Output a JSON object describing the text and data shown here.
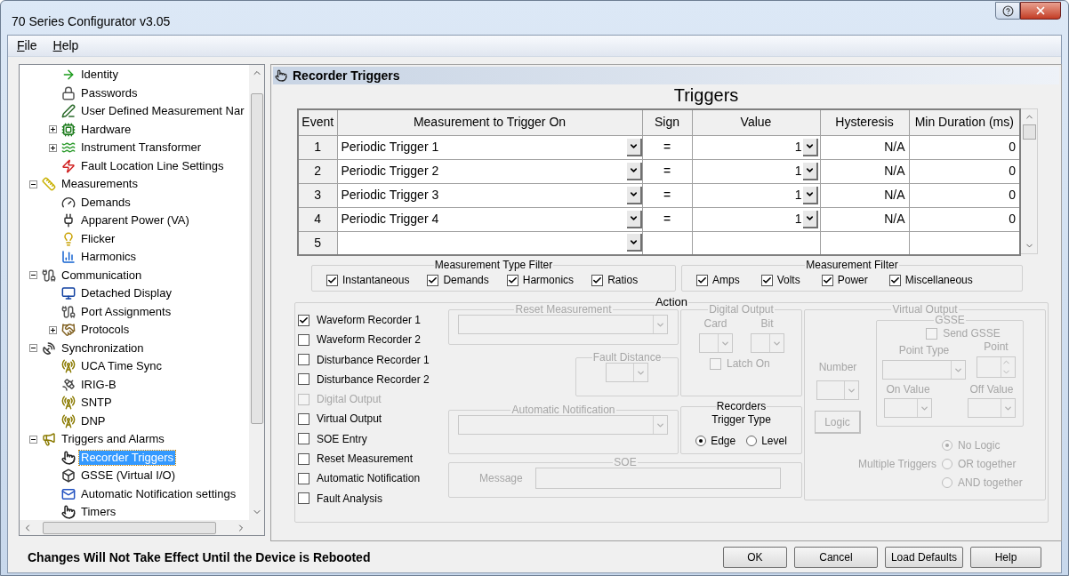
{
  "window": {
    "title": "70 Series Configurator v3.05"
  },
  "menu": [
    {
      "label": "File"
    },
    {
      "label": "Help"
    }
  ],
  "tree": {
    "continued_children": [
      {
        "label": "Identity",
        "selected": false
      },
      {
        "label": "Passwords",
        "selected": false
      },
      {
        "label": "User Defined Measurement Nar",
        "selected": false
      },
      {
        "label": "Hardware",
        "selected": false,
        "expanded": false
      },
      {
        "label": "Instrument Transformer",
        "selected": false,
        "expanded": false
      },
      {
        "label": "Fault Location Line Settings",
        "selected": false
      }
    ],
    "items": [
      {
        "label": "Measurements",
        "selected": false,
        "expanded": true,
        "children": [
          {
            "label": "Demands",
            "selected": false
          },
          {
            "label": "Apparent Power (VA)",
            "selected": false
          },
          {
            "label": "Flicker",
            "selected": false
          },
          {
            "label": "Harmonics",
            "selected": false
          }
        ]
      },
      {
        "label": "Communication",
        "selected": false,
        "expanded": true,
        "children": [
          {
            "label": "Detached Display",
            "selected": false
          },
          {
            "label": "Port Assignments",
            "selected": false
          },
          {
            "label": "Protocols",
            "selected": false,
            "expanded": false
          }
        ]
      },
      {
        "label": "Synchronization",
        "selected": false,
        "expanded": true,
        "children": [
          {
            "label": "UCA Time Sync",
            "selected": false
          },
          {
            "label": "IRIG-B",
            "selected": false
          },
          {
            "label": "SNTP",
            "selected": false
          },
          {
            "label": "DNP",
            "selected": false
          }
        ]
      },
      {
        "label": "Triggers and Alarms",
        "selected": false,
        "expanded": true,
        "children": [
          {
            "label": "Recorder Triggers",
            "selected": true
          },
          {
            "label": "GSSE (Virtual I/O)",
            "selected": false
          },
          {
            "label": "Automatic Notification settings",
            "selected": false
          },
          {
            "label": "Timers",
            "selected": false
          }
        ]
      }
    ]
  },
  "panel": {
    "title": "Recorder Triggers"
  },
  "triggers": {
    "title": "Triggers",
    "columns": [
      "Event",
      "Measurement to Trigger On",
      "Sign",
      "Value",
      "Hysteresis",
      "Min Duration (ms)"
    ],
    "rows": [
      {
        "event": "1",
        "measurement": "Periodic Trigger 1",
        "sign": "=",
        "value": "1",
        "hysteresis": "N/A",
        "min_duration": "0"
      },
      {
        "event": "2",
        "measurement": "Periodic Trigger 2",
        "sign": "=",
        "value": "1",
        "hysteresis": "N/A",
        "min_duration": "0"
      },
      {
        "event": "3",
        "measurement": "Periodic Trigger 3",
        "sign": "=",
        "value": "1",
        "hysteresis": "N/A",
        "min_duration": "0"
      },
      {
        "event": "4",
        "measurement": "Periodic Trigger 4",
        "sign": "=",
        "value": "1",
        "hysteresis": "N/A",
        "min_duration": "0"
      },
      {
        "event": "5"
      }
    ]
  },
  "measurement_type_filter": {
    "title": "Measurement Type Filter",
    "options": [
      {
        "label": "Instantaneous",
        "checked": true
      },
      {
        "label": "Demands",
        "checked": true
      },
      {
        "label": "Harmonics",
        "checked": true
      },
      {
        "label": "Ratios",
        "checked": true
      }
    ]
  },
  "measurement_filter": {
    "title": "Measurement Filter",
    "options": [
      {
        "label": "Amps",
        "checked": true
      },
      {
        "label": "Volts",
        "checked": true
      },
      {
        "label": "Power",
        "checked": true
      },
      {
        "label": "Miscellaneous",
        "checked": true
      }
    ]
  },
  "action": {
    "title": "Action",
    "outputs": [
      {
        "label": "Waveform Recorder 1",
        "checked": true,
        "disabled": false
      },
      {
        "label": "Waveform Recorder 2",
        "checked": false,
        "disabled": false
      },
      {
        "label": "Disturbance Recorder 1",
        "checked": false,
        "disabled": false
      },
      {
        "label": "Disturbance Recorder 2",
        "checked": false,
        "disabled": false
      },
      {
        "label": "Digital Output",
        "checked": false,
        "disabled": true
      },
      {
        "label": "Virtual Output",
        "checked": false,
        "disabled": false
      },
      {
        "label": "SOE Entry",
        "checked": false,
        "disabled": false
      },
      {
        "label": "Reset Measurement",
        "checked": false,
        "disabled": false
      },
      {
        "label": "Automatic Notification",
        "checked": false,
        "disabled": false
      },
      {
        "label": "Fault Analysis",
        "checked": false,
        "disabled": false
      }
    ],
    "reset_measurement": {
      "title": "Reset Measurement",
      "disabled": true
    },
    "fault_distance": {
      "title": "Fault Distance",
      "disabled": true
    },
    "digital_output": {
      "title": "Digital Output",
      "disabled": true,
      "card_label": "Card",
      "bit_label": "Bit",
      "latch_on": {
        "label": "Latch On",
        "checked": false
      }
    },
    "automatic_notification": {
      "title": "Automatic Notification",
      "disabled": true
    },
    "recorders": {
      "title": "Recorders",
      "subtitle": "Trigger Type",
      "disabled": false,
      "options": [
        {
          "label": "Edge",
          "selected": true
        },
        {
          "label": "Level",
          "selected": false
        }
      ]
    },
    "soe": {
      "title": "SOE",
      "disabled": true,
      "message_label": "Message"
    },
    "virtual_output": {
      "title": "Virtual Output",
      "disabled": true,
      "number_label": "Number",
      "logic_button": "Logic",
      "gsse": {
        "title": "GSSE",
        "send_gsse": {
          "label": "Send GSSE",
          "checked": false
        },
        "point_type_label": "Point Type",
        "point_label": "Point",
        "on_value_label": "On Value",
        "off_value_label": "Off Value"
      },
      "multiple_triggers_label": "Multiple Triggers",
      "multiple_triggers": [
        {
          "label": "No Logic",
          "selected": true
        },
        {
          "label": "OR together",
          "selected": false
        },
        {
          "label": "AND together",
          "selected": false
        }
      ]
    }
  },
  "status": {
    "message": "Changes Will Not Take Effect Until the Device is Rebooted"
  },
  "buttons": [
    {
      "label": "OK"
    },
    {
      "label": "Cancel"
    },
    {
      "label": "Load Defaults"
    },
    {
      "label": "Help"
    }
  ]
}
